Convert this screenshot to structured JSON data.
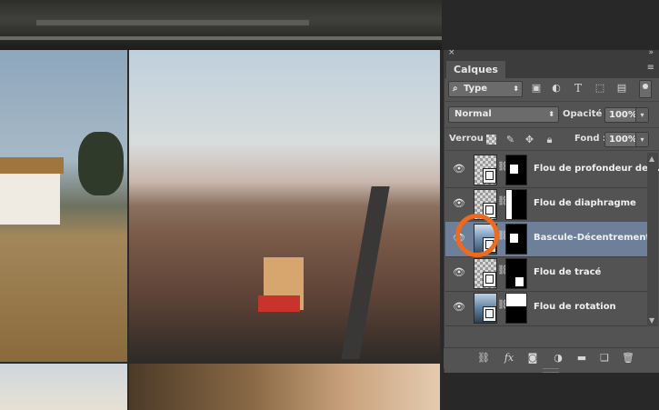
{
  "panel": {
    "close_glyph": "×",
    "collapse_glyph": "»",
    "tab_label": "Calques",
    "menu_glyph": "≡"
  },
  "filter": {
    "kind_label": "Type",
    "icons": [
      "image-filter-icon",
      "adjustment-filter-icon",
      "text-filter-icon",
      "shape-filter-icon",
      "smart-object-filter-icon"
    ]
  },
  "blend": {
    "mode": "Normal",
    "opacity_label": "Opacité :",
    "opacity_value": "100%",
    "lock_label": "Verrou :",
    "fill_label": "Fond :",
    "fill_value": "100%"
  },
  "layers": [
    {
      "name": "Flou de profondeur de c...",
      "selected": false,
      "thumb": "checker",
      "mask": "small-square"
    },
    {
      "name": "Flou de diaphragme",
      "selected": false,
      "thumb": "checker",
      "mask": "circle"
    },
    {
      "name": "Bascule-Décentrement",
      "selected": true,
      "thumb": "photo",
      "mask": "small-square"
    },
    {
      "name": "Flou de tracé",
      "selected": false,
      "thumb": "checker",
      "mask": "small-square"
    },
    {
      "name": "Flou de rotation",
      "selected": false,
      "thumb": "photo",
      "mask": "black-bottom"
    }
  ],
  "bottom_icons": [
    "link-layers-icon",
    "fx-icon",
    "add-mask-icon",
    "adjustment-layer-icon",
    "new-group-icon",
    "new-layer-icon",
    "delete-layer-icon"
  ],
  "colors": {
    "panel_bg": "#535353",
    "selected_layer": "#6d7f99",
    "highlight_circle": "#ee6a1c"
  }
}
